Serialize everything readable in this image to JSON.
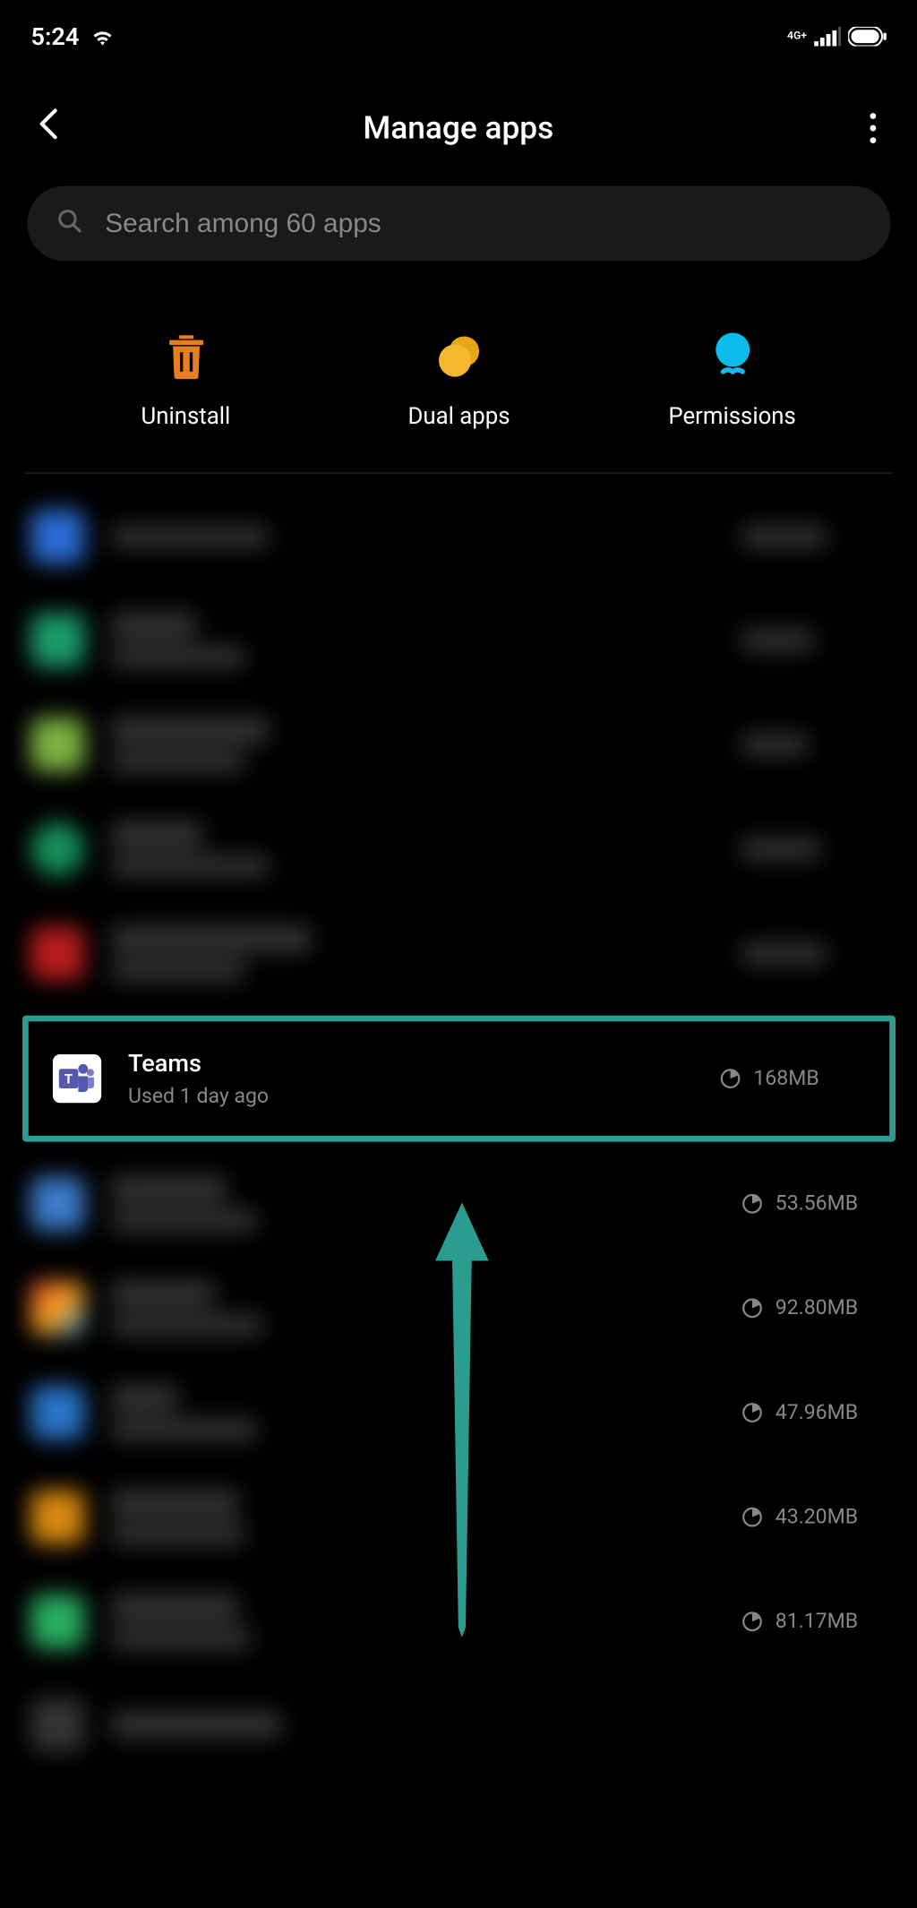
{
  "statusBar": {
    "time": "5:24",
    "network": "4G+"
  },
  "header": {
    "title": "Manage apps"
  },
  "search": {
    "placeholder": "Search among 60 apps"
  },
  "actions": {
    "uninstall": "Uninstall",
    "dualApps": "Dual apps",
    "permissions": "Permissions"
  },
  "highlightedApp": {
    "name": "Teams",
    "usage": "Used 1 day ago",
    "size": "168MB"
  },
  "visibleSizes": {
    "row6": "53.56MB",
    "row7": "92.80MB",
    "row8": "47.96MB",
    "row9": "43.20MB",
    "row10": "81.17MB"
  }
}
